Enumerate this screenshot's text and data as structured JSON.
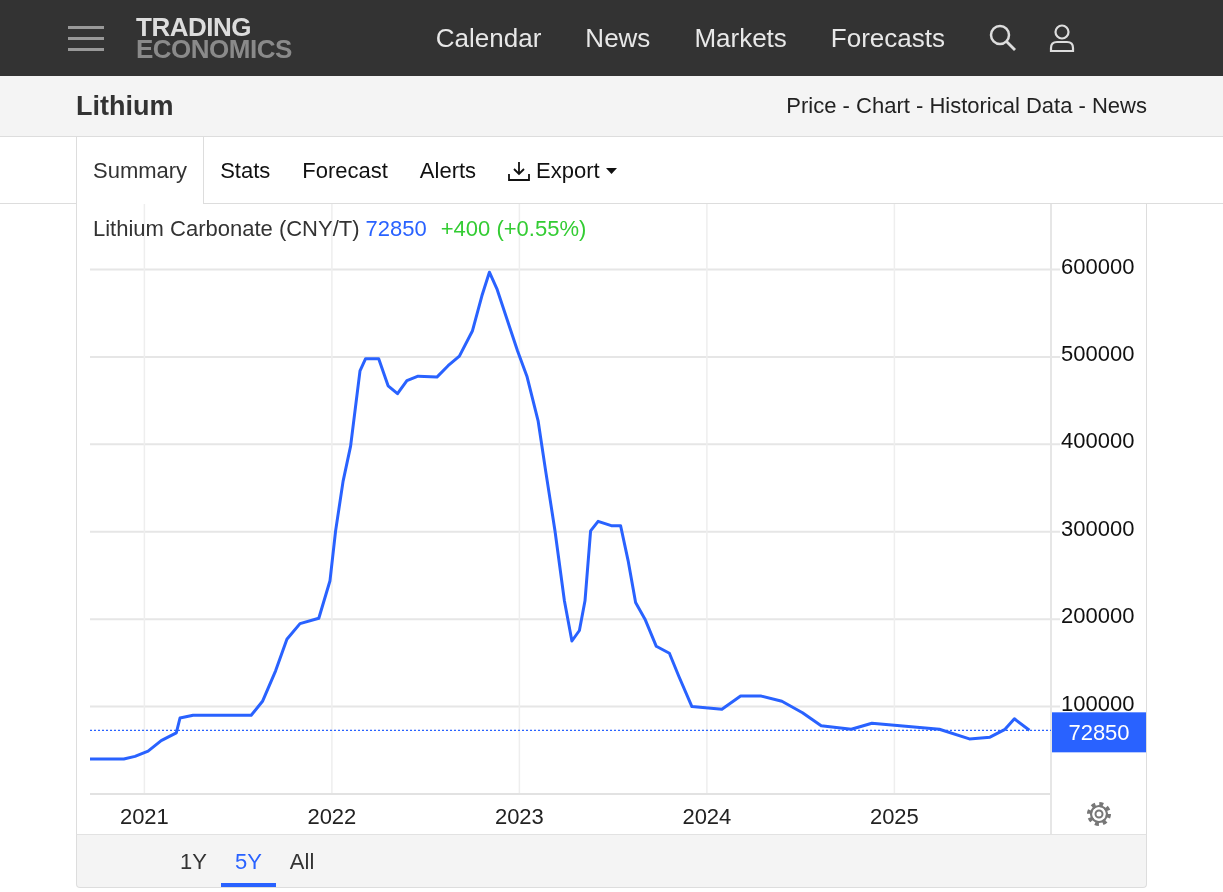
{
  "header": {
    "logo": {
      "line_1": "TRADING",
      "line_2": "ECONOMICS"
    },
    "nav": [
      "Calendar",
      "News",
      "Markets",
      "Forecasts"
    ]
  },
  "title_bar": {
    "title": "Lithium",
    "links": "Price - Chart - Historical Data - News"
  },
  "tabs": [
    {
      "label": "Summary",
      "selected": true,
      "kind": "tab"
    },
    {
      "label": "Stats",
      "selected": false,
      "kind": "tab"
    },
    {
      "label": "Forecast",
      "selected": false,
      "kind": "tab"
    },
    {
      "label": "Alerts",
      "selected": false,
      "kind": "tab"
    },
    {
      "label": "Export",
      "selected": false,
      "kind": "dropdown"
    }
  ],
  "chart": {
    "legend": {
      "price": "72850",
      "change": "+400 (+0.55%)"
    },
    "chart_data": {
      "type": "line",
      "grid": true,
      "ref_lines": [
        {
          "axis": "y",
          "value": 72850,
          "label": "72850",
          "color": "#2962ff"
        }
      ],
      "xlim": [
        2020.71,
        2025.83
      ],
      "ylim": [
        0,
        675000
      ],
      "xticks": [
        2021,
        2022,
        2023,
        2024,
        2025
      ],
      "yticks": [
        100000,
        200000,
        300000,
        400000,
        500000,
        600000
      ],
      "x": [
        2020.71,
        2020.89,
        2020.95,
        2021.02,
        2021.09,
        2021.17,
        2021.19,
        2021.26,
        2021.35,
        2021.57,
        2021.63,
        2021.7,
        2021.76,
        2021.83,
        2021.93,
        2021.99,
        2022.02,
        2022.06,
        2022.1,
        2022.15,
        2022.18,
        2022.25,
        2022.3,
        2022.35,
        2022.4,
        2022.46,
        2022.56,
        2022.62,
        2022.68,
        2022.75,
        2022.8,
        2022.84,
        2022.88,
        2022.99,
        2023.04,
        2023.1,
        2023.14,
        2023.19,
        2023.24,
        2023.28,
        2023.32,
        2023.35,
        2023.38,
        2023.42,
        2023.49,
        2023.54,
        2023.58,
        2023.62,
        2023.67,
        2023.73,
        2023.8,
        2023.85,
        2023.92,
        2024.08,
        2024.18,
        2024.29,
        2024.4,
        2024.51,
        2024.61,
        2024.77,
        2024.88,
        2025.03,
        2025.24,
        2025.4,
        2025.51,
        2025.59,
        2025.64,
        2025.72
      ],
      "series": [
        {
          "name": "Lithium Carbonate (CNY/T)",
          "color": "#2962ff",
          "values": [
            40000,
            40000,
            43000,
            49000,
            61000,
            70000,
            87000,
            90000,
            90000,
            90000,
            106000,
            141000,
            177000,
            195000,
            201000,
            244000,
            301000,
            358000,
            398000,
            484000,
            498000,
            498000,
            467000,
            458000,
            473000,
            478000,
            477000,
            490000,
            501000,
            530000,
            570000,
            597000,
            578000,
            507000,
            478000,
            427000,
            370000,
            301000,
            221000,
            175000,
            187000,
            221000,
            301000,
            312000,
            307000,
            307000,
            267000,
            219000,
            200000,
            169000,
            161000,
            135000,
            100000,
            97000,
            112000,
            112000,
            106000,
            93000,
            78000,
            74000,
            81000,
            78000,
            74000,
            63000,
            65000,
            74000,
            86000,
            73000
          ]
        }
      ]
    }
  },
  "ranges": [
    {
      "label": "1Y",
      "selected": false
    },
    {
      "label": "5Y",
      "selected": true
    },
    {
      "label": "All",
      "selected": false
    }
  ]
}
